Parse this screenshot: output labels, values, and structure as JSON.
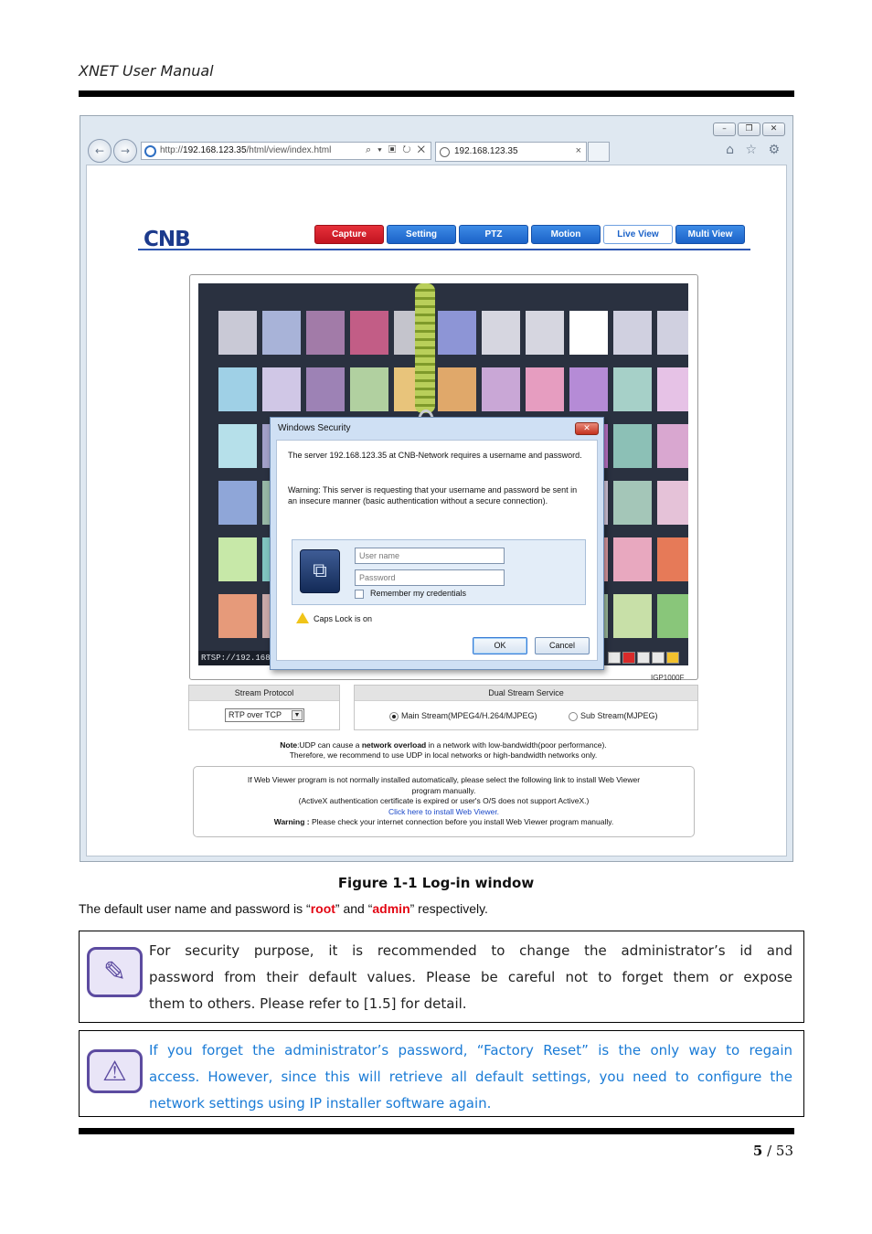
{
  "header": {
    "title": "XNET User Manual"
  },
  "browser": {
    "window_buttons": [
      "–",
      "❐",
      "✕"
    ],
    "back_glyph": "←",
    "forward_glyph": "→",
    "address_prefix": "http://",
    "address_host": "192.168.123.35",
    "address_path": "/html/view/index.html",
    "address_tools": "⌕ ▾ ▣ ↻ ✕",
    "tab_title": "192.168.123.35",
    "tab_close": "×",
    "right_icons": "⌂ ☆ ⚙"
  },
  "app": {
    "logo": "CNB",
    "nav": [
      "Capture",
      "Setting",
      "PTZ",
      "Motion",
      "Live View",
      "Multi View"
    ],
    "video_overlay": "RTSP://192.168.",
    "model": "IGP1000F"
  },
  "dialog": {
    "title": "Windows Security",
    "close_glyph": "✕",
    "message1": "The server 192.168.123.35 at CNB-Network requires a username and password.",
    "message2": "Warning: This server is requesting that your username and password be sent in an insecure manner (basic authentication without a secure connection).",
    "credential_icon": "⧉",
    "username_placeholder": "User name",
    "password_placeholder": "Password",
    "remember": "Remember my credentials",
    "caps_lock": "Caps Lock is on",
    "ok": "OK",
    "cancel": "Cancel"
  },
  "stream": {
    "protocol_label": "Stream Protocol",
    "protocol_value": "RTP over TCP",
    "select_arrow": "▼",
    "dual_label": "Dual Stream Service",
    "main_stream": "Main Stream(MPEG4/H.264/MJPEG)",
    "sub_stream": "Sub Stream(MJPEG)",
    "selected": "main"
  },
  "note": {
    "bold_prefix": "Note",
    "line1_a": ":UDP can cause a ",
    "line1_bold": "network overload",
    "line1_b": " in a network with low-bandwidth(poor performance).",
    "line2": "Therefore, we recommend to use UDP in local networks or high-bandwidth networks only."
  },
  "install_box": {
    "line1": "If Web Viewer program is not normally installed automatically, please select the following link to install Web Viewer",
    "line2": "program manually.",
    "line3": "(ActiveX authentication certificate is expired or user's O/S does not support ActiveX.)",
    "link": "Click here to install Web Viewer.",
    "warning_bold": "Warning :",
    "warning_text": " Please check your internet connection before you install Web Viewer program manually."
  },
  "caption": "Figure 1-1 Log-in window",
  "paragraph": {
    "part1": "The default user name and password is “",
    "user": "root",
    "part2": "” and “",
    "pass": "admin",
    "part3": "” respectively."
  },
  "note_box": {
    "icon_glyph": "✎",
    "line1": "For security purpose, it is recommended to change the administrator’s id and",
    "line2": "password from their default values. Please be careful not to forget them or expose",
    "line3": "them to others.   Please refer to [1.5] for detail."
  },
  "warn_box": {
    "icon_glyph": "⚠",
    "line1": "If you forget the administrator’s password, “Factory Reset” is the only way to regain",
    "line2": "access. However, since this will retrieve all default settings, you need to configure the",
    "line3": "network settings using IP installer software again."
  },
  "footer": {
    "page": "5",
    "sep": " / ",
    "total": "53"
  },
  "colors": {
    "accent_red": "#e30613",
    "link_blue": "#1a7bd6",
    "nav_blue": "#1b62c8",
    "nav_red": "#c21420"
  }
}
